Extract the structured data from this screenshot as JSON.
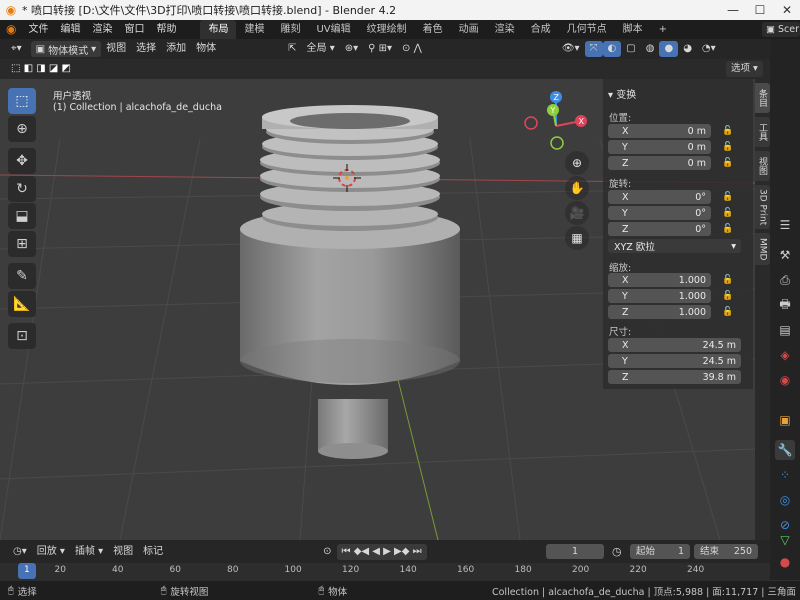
{
  "title_bar": {
    "title": "* 喷口转接 [D:\\文件\\文件\\3D打印\\喷口转接\\喷口转接.blend] - Blender 4.2",
    "minimize": "—",
    "maximize": "☐",
    "close": "✕"
  },
  "menu": {
    "items": [
      "文件",
      "编辑",
      "渲染",
      "窗口",
      "帮助"
    ],
    "workspaces": [
      "布局",
      "建模",
      "雕刻",
      "UV编辑",
      "纹理绘制",
      "着色",
      "动画",
      "渲染",
      "合成",
      "几何节点",
      "脚本"
    ],
    "active_workspace": "布局",
    "add_tab": "+",
    "scene": "Scer"
  },
  "header": {
    "mode": "物体模式",
    "menus": [
      "视图",
      "选择",
      "添加",
      "物体"
    ],
    "transform_orientation": "全局",
    "options": "选项"
  },
  "viewport": {
    "view_name": "用户透视",
    "collection_info": "(1) Collection | alcachofa_de_ducha"
  },
  "n_panel": {
    "section": "变换",
    "location_label": "位置:",
    "location": [
      {
        "axis": "X",
        "value": "0 m"
      },
      {
        "axis": "Y",
        "value": "0 m"
      },
      {
        "axis": "Z",
        "value": "0 m"
      }
    ],
    "rotation_label": "旋转:",
    "rotation": [
      {
        "axis": "X",
        "value": "0°"
      },
      {
        "axis": "Y",
        "value": "0°"
      },
      {
        "axis": "Z",
        "value": "0°"
      }
    ],
    "rotation_mode": "XYZ 欧拉",
    "scale_label": "缩放:",
    "scale": [
      {
        "axis": "X",
        "value": "1.000"
      },
      {
        "axis": "Y",
        "value": "1.000"
      },
      {
        "axis": "Z",
        "value": "1.000"
      }
    ],
    "dimensions_label": "尺寸:",
    "dimensions": [
      {
        "axis": "X",
        "value": "24.5 m"
      },
      {
        "axis": "Y",
        "value": "24.5 m"
      },
      {
        "axis": "Z",
        "value": "39.8 m"
      }
    ]
  },
  "side_tabs": [
    "条目",
    "工具",
    "视图",
    "3D Print",
    "MMD"
  ],
  "timeline": {
    "menus": [
      "回放",
      "插帧",
      "视图",
      "标记"
    ],
    "current_frame": "1",
    "start_label": "起始",
    "start": "1",
    "end_label": "结束",
    "end": "250",
    "ticks": [
      "1",
      "20",
      "40",
      "60",
      "80",
      "100",
      "120",
      "140",
      "160",
      "180",
      "200",
      "220",
      "240"
    ]
  },
  "status_bar": {
    "select": "选择",
    "rotate_view": "旋转视图",
    "object": "物体",
    "stats": "Collection | alcachofa_de_ducha | 顶点:5,988 | 面:11,717 | 三角面"
  },
  "colors": {
    "accent": "#4772b3",
    "axis_x": "#e0445a",
    "axis_y": "#8ccf3a",
    "axis_z": "#3e8ee8",
    "active_frame": "#4772b3"
  }
}
